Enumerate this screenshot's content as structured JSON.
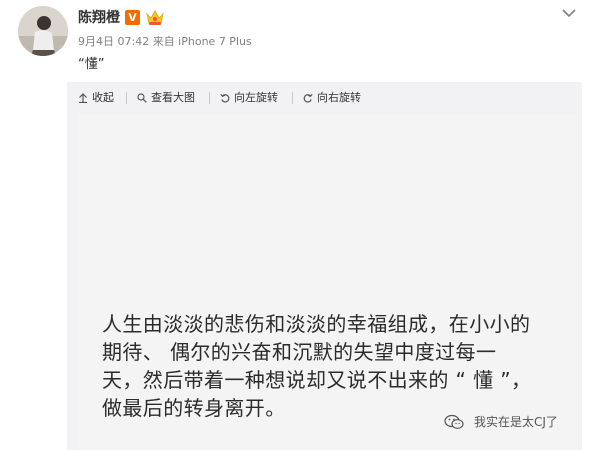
{
  "post": {
    "username": "陈翔橙",
    "verified_badge": "V",
    "meta": "9月4日 07:42 来自 iPhone 7 Plus",
    "text": "“懂”"
  },
  "toolbar": {
    "collapse": "收起",
    "view_large": "查看大图",
    "rotate_left": "向左旋转",
    "rotate_right": "向右旋转"
  },
  "image": {
    "lines": [
      "人生由淡淡的悲伤和淡淡的幸福组成，在小小的",
      "期待、 偶尔的兴奋和沉默的失望中度过每一",
      "天，然后带着一种想说却又说不出来的 “ 懂 ”，",
      "做最后的转身离开。"
    ],
    "watermark": "我实在是太CJ了"
  },
  "colors": {
    "badge_orange": "#f46b00",
    "panel_bg": "#f2f2f5"
  },
  "icons": {
    "collapse": "arrow-up-icon",
    "view_large": "magnifier-icon",
    "rotate_left": "rotate-left-icon",
    "rotate_right": "rotate-right-icon",
    "menu": "chevron-down-icon",
    "watermark": "wechat-icon"
  }
}
